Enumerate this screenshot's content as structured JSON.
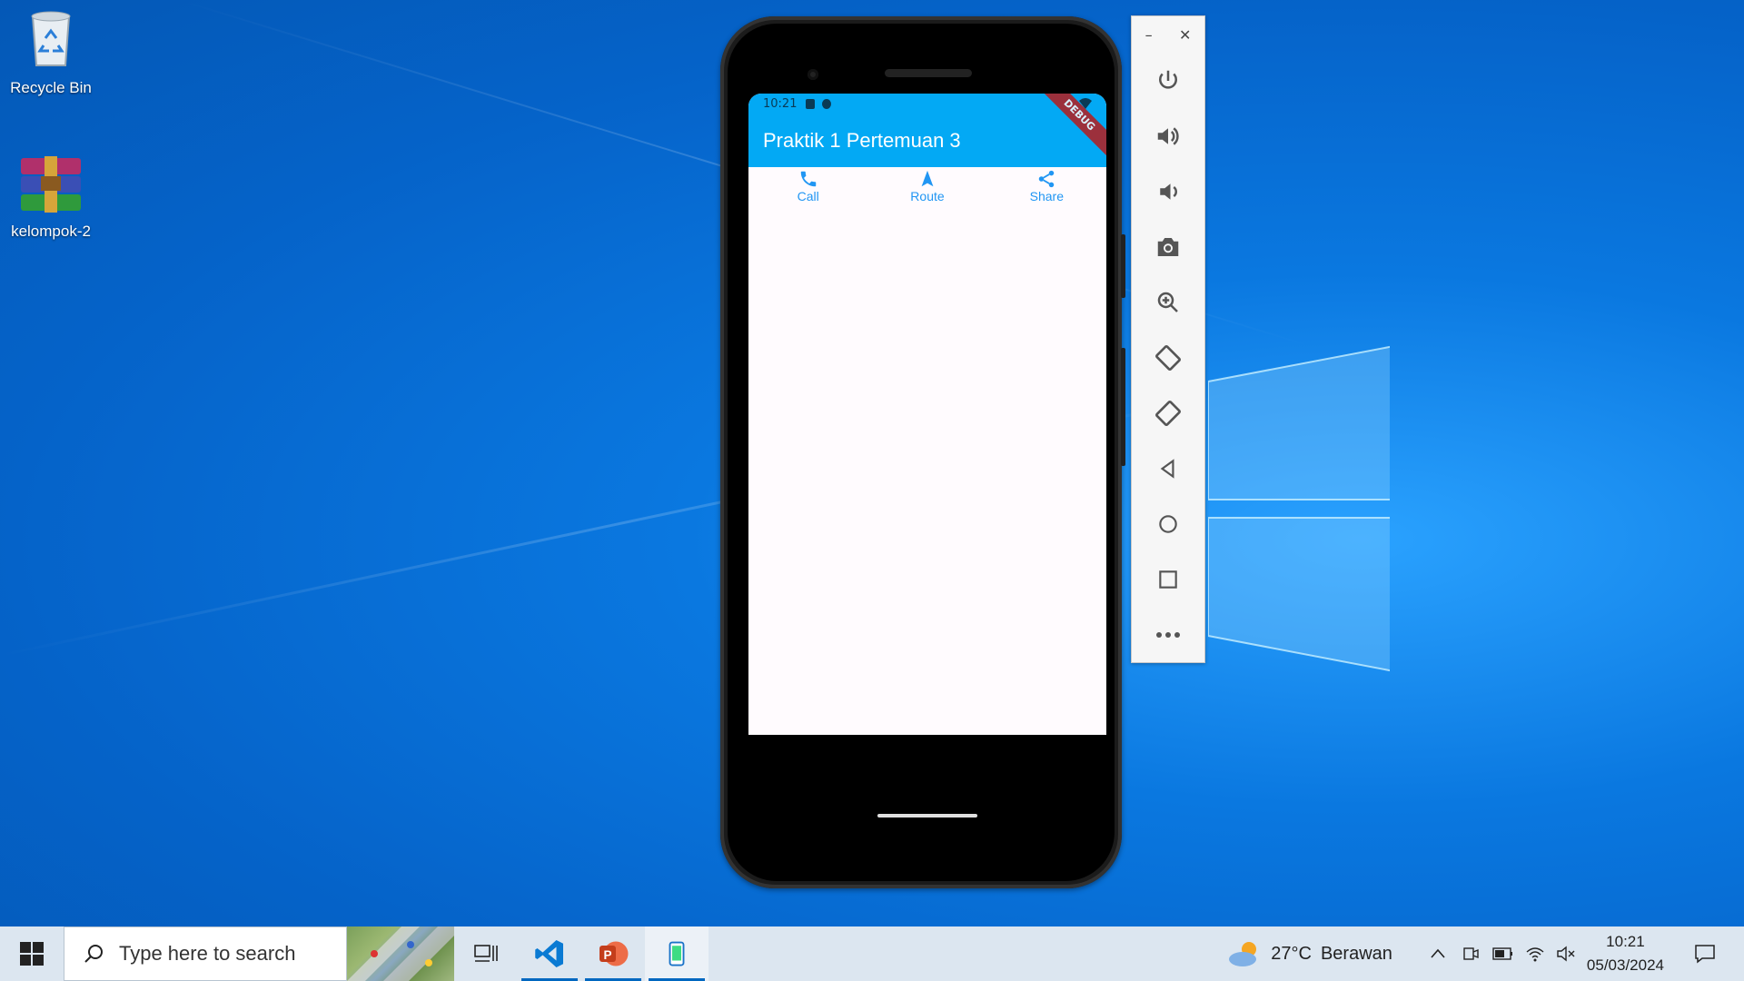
{
  "desktop": {
    "icons": [
      {
        "label": "Recycle Bin",
        "icon": "recycle-bin-icon"
      },
      {
        "label": "kelompok-2",
        "icon": "winrar-archive-icon"
      }
    ]
  },
  "phone": {
    "status": {
      "time": "10:21"
    },
    "app_title": "Praktik 1 Pertemuan 3",
    "debug_banner": "DEBUG",
    "actions": [
      {
        "label": "Call",
        "icon": "phone-icon"
      },
      {
        "label": "Route",
        "icon": "navigation-arrow-icon"
      },
      {
        "label": "Share",
        "icon": "share-icon"
      }
    ],
    "colors": {
      "appbar": "#03a9f4",
      "action": "#2196f3",
      "screen": "#fffbfe"
    }
  },
  "emulator_toolbar": {
    "window_controls": {
      "minimize": "–",
      "close": "✕"
    },
    "buttons": [
      "power-icon",
      "volume-up-icon",
      "volume-down-icon",
      "camera-icon",
      "zoom-in-icon",
      "rotate-left-icon",
      "rotate-right-icon",
      "back-icon",
      "home-icon",
      "overview-icon",
      "more-icon"
    ]
  },
  "taskbar": {
    "search_placeholder": "Type here to search",
    "apps": [
      "task-view-icon",
      "vscode-icon",
      "powerpoint-icon",
      "emulator-icon"
    ],
    "weather": {
      "temp": "27°C",
      "condition": "Berawan"
    },
    "clock": {
      "time": "10:21",
      "date": "05/03/2024"
    }
  }
}
